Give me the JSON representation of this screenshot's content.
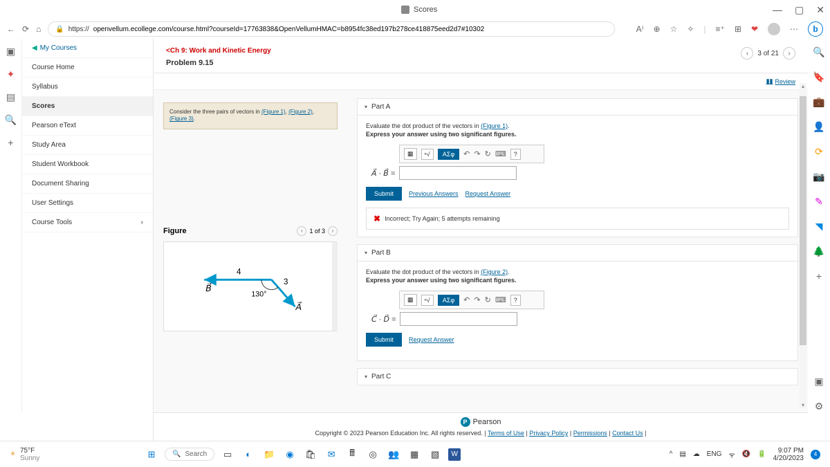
{
  "browser": {
    "tab_title": "Scores",
    "url": "https://openvellum.ecollege.com/course.html?courseId=17763838&OpenVellumHMAC=b8954fc38ed197b278ce418875eed2d7#10302",
    "url_prefix": "https://",
    "url_display": "openvellum.ecollege.com/course.html?courseId=17763838&OpenVellumHMAC=b8954fc38ed197b278ce418875eed2d7#10302"
  },
  "nav": {
    "my_courses": "My Courses",
    "course_home": "Course Home",
    "syllabus": "Syllabus",
    "scores": "Scores",
    "etext": "Pearson eText",
    "study_area": "Study Area",
    "workbook": "Student Workbook",
    "doc_sharing": "Document Sharing",
    "user_settings": "User Settings",
    "course_tools": "Course Tools"
  },
  "header": {
    "back": "Ch 9: Work and Kinetic Energy",
    "problem": "Problem 9.15",
    "pager": "3 of 21",
    "review": "Review"
  },
  "problem": {
    "consider_pre": "Consider the three pairs of vectors in ",
    "fig1": "(Figure 1)",
    "fig2": "(Figure 2)",
    "fig3": "(Figure 3)"
  },
  "figure": {
    "title": "Figure",
    "pager": "1 of 3",
    "vec_b": "B",
    "vec_a": "A",
    "len_b": "4",
    "len_a": "3",
    "angle": "130°"
  },
  "partA": {
    "title": "Part A",
    "instr_pre": "Evaluate the dot product of the vectors in ",
    "fig": "(Figure 1)",
    "express": "Express your answer using two significant figures.",
    "label": "A⃗ · B⃗ =",
    "submit": "Submit",
    "prev": "Previous Answers",
    "req": "Request Answer",
    "feedback": "Incorrect; Try Again; 5 attempts remaining"
  },
  "partB": {
    "title": "Part B",
    "instr_pre": "Evaluate the dot product of the vectors in ",
    "fig": "(Figure 2)",
    "express": "Express your answer using two significant figures.",
    "label": "C⃗ · D⃗ =",
    "submit": "Submit",
    "req": "Request Answer"
  },
  "partC": {
    "title": "Part C"
  },
  "toolbar": {
    "sigma": "ΑΣφ",
    "help": "?"
  },
  "footer": {
    "brand": "Pearson",
    "copyright": "Copyright © 2023 Pearson Education Inc. All rights reserved. | ",
    "terms": "Terms of Use",
    "privacy": "Privacy Policy",
    "permissions": "Permissions",
    "contact": "Contact Us"
  },
  "taskbar": {
    "temp": "75°F",
    "cond": "Sunny",
    "search": "Search",
    "lang": "ENG",
    "time": "9:07 PM",
    "date": "4/20/2023",
    "notif": "4"
  }
}
